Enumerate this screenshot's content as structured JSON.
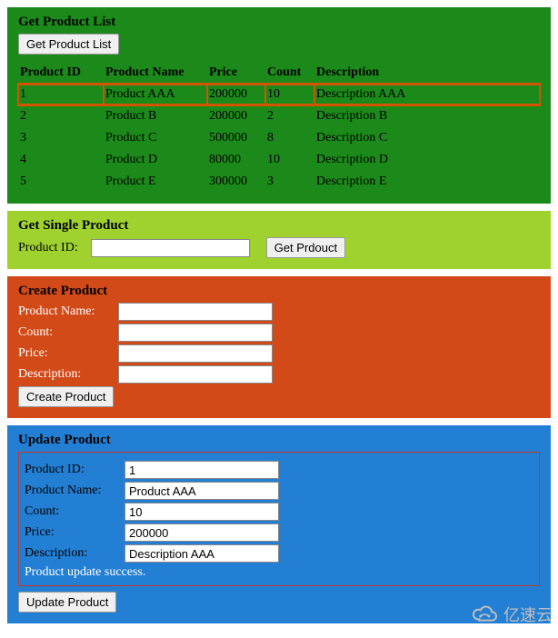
{
  "list": {
    "title": "Get Product List",
    "button": "Get Product List",
    "headers": {
      "id": "Product ID",
      "name": "Product Name",
      "price": "Price",
      "count": "Count",
      "desc": "Description"
    },
    "rows": [
      {
        "id": "1",
        "name": "Product AAA",
        "price": "200000",
        "count": "10",
        "desc": "Description AAA",
        "selected": true
      },
      {
        "id": "2",
        "name": "Product B",
        "price": "200000",
        "count": "2",
        "desc": "Description B",
        "selected": false
      },
      {
        "id": "3",
        "name": "Product C",
        "price": "500000",
        "count": "8",
        "desc": "Description C",
        "selected": false
      },
      {
        "id": "4",
        "name": "Product D",
        "price": "80000",
        "count": "10",
        "desc": "Description D",
        "selected": false
      },
      {
        "id": "5",
        "name": "Product E",
        "price": "300000",
        "count": "3",
        "desc": "Description E",
        "selected": false
      }
    ]
  },
  "single": {
    "title": "Get Single Product",
    "label": "Product ID:",
    "value": "",
    "button": "Get Prdouct"
  },
  "create": {
    "title": "Create Product",
    "labels": {
      "name": "Product Name:",
      "count": "Count:",
      "price": "Price:",
      "desc": "Description:"
    },
    "values": {
      "name": "",
      "count": "",
      "price": "",
      "desc": ""
    },
    "button": "Create Product"
  },
  "update": {
    "title": "Update Product",
    "labels": {
      "id": "Product ID:",
      "name": "Product Name:",
      "count": "Count:",
      "price": "Price:",
      "desc": "Description:"
    },
    "values": {
      "id": "1",
      "name": "Product AAA",
      "count": "10",
      "price": "200000",
      "desc": "Description AAA"
    },
    "status": "Product update success.",
    "button": "Update Product"
  },
  "watermark": "亿速云"
}
